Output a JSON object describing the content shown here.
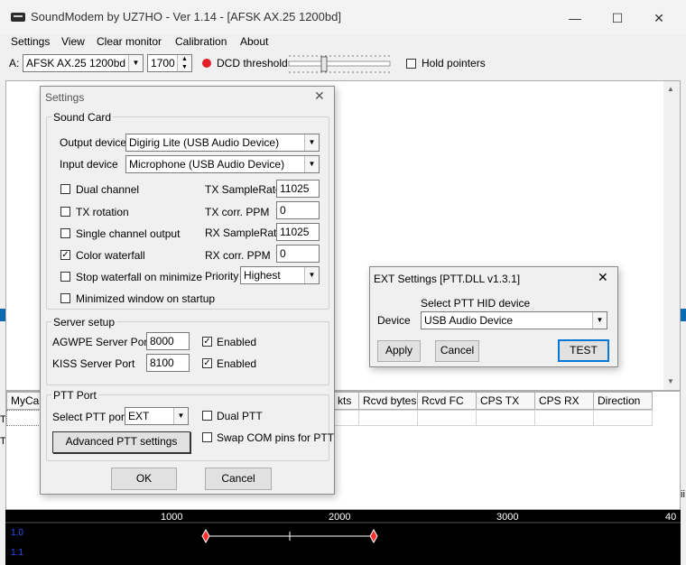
{
  "window": {
    "title": "SoundModem by UZ7HO - Ver 1.14 - [AFSK AX.25 1200bd]",
    "minimize": "—",
    "maximize": "☐",
    "close": "✕"
  },
  "menu": [
    "Settings",
    "View",
    "Clear monitor",
    "Calibration",
    "About"
  ],
  "toolbar": {
    "channel_label": "A:",
    "mode": "AFSK AX.25 1200bd",
    "freq": "1700",
    "dcd_label": "DCD threshold",
    "hold_label": "Hold pointers"
  },
  "table": {
    "headers": [
      "MyCall",
      "kts",
      "Rcvd bytes",
      "Rcvd FC",
      "CPS TX",
      "CPS RX",
      "Direction"
    ]
  },
  "waterfall": {
    "ticks": [
      "1000",
      "2000",
      "3000",
      "40"
    ],
    "left_labels": [
      "1.0",
      "1.1"
    ]
  },
  "side_fragments": {
    "left1": "T",
    "left2": "T",
    "right1": "ii"
  },
  "settings": {
    "title": "Settings",
    "close": "✕",
    "sound_card": {
      "title": "Sound Card",
      "output_label": "Output device",
      "output_value": "Digirig Lite (USB Audio Device)",
      "input_label": "Input device",
      "input_value": "Microphone (USB Audio Device)",
      "options": [
        {
          "label": "Dual channel",
          "checked": false
        },
        {
          "label": "TX rotation",
          "checked": false
        },
        {
          "label": "Single channel output",
          "checked": false
        },
        {
          "label": "Color waterfall",
          "checked": true
        },
        {
          "label": "Stop waterfall on minimize",
          "checked": false
        },
        {
          "label": "Minimized window on startup",
          "checked": false
        }
      ],
      "tx_samplerate_label": "TX SampleRate",
      "tx_samplerate": "11025",
      "tx_ppm_label": "TX corr. PPM",
      "tx_ppm": "0",
      "rx_samplerate_label": "RX SampleRate",
      "rx_samplerate": "11025",
      "rx_ppm_label": "RX corr. PPM",
      "rx_ppm": "0",
      "priority_label": "Priority",
      "priority_value": "Highest"
    },
    "server": {
      "title": "Server setup",
      "agwpe_label": "AGWPE Server Port",
      "agwpe_port": "8000",
      "agwpe_enabled": "Enabled",
      "kiss_label": "KISS Server Port",
      "kiss_port": "8100",
      "kiss_enabled": "Enabled"
    },
    "ptt": {
      "title": "PTT Port",
      "select_label": "Select PTT port",
      "select_value": "EXT",
      "dual_ptt": "Dual PTT",
      "swap_com": "Swap COM pins for PTT",
      "advanced": "Advanced PTT settings"
    },
    "ok": "OK",
    "cancel": "Cancel"
  },
  "ext": {
    "title": "EXT Settings [PTT.DLL v1.3.1]",
    "close": "✕",
    "select_label": "Select PTT HID device",
    "device_label": "Device",
    "device_value": "USB Audio Device",
    "apply": "Apply",
    "cancel": "Cancel",
    "test": "TEST"
  },
  "colors": {
    "accent": "#0078d7",
    "led": "#e3202a",
    "waterfall_bg": "#000000",
    "strip": "#0a6bb0"
  }
}
